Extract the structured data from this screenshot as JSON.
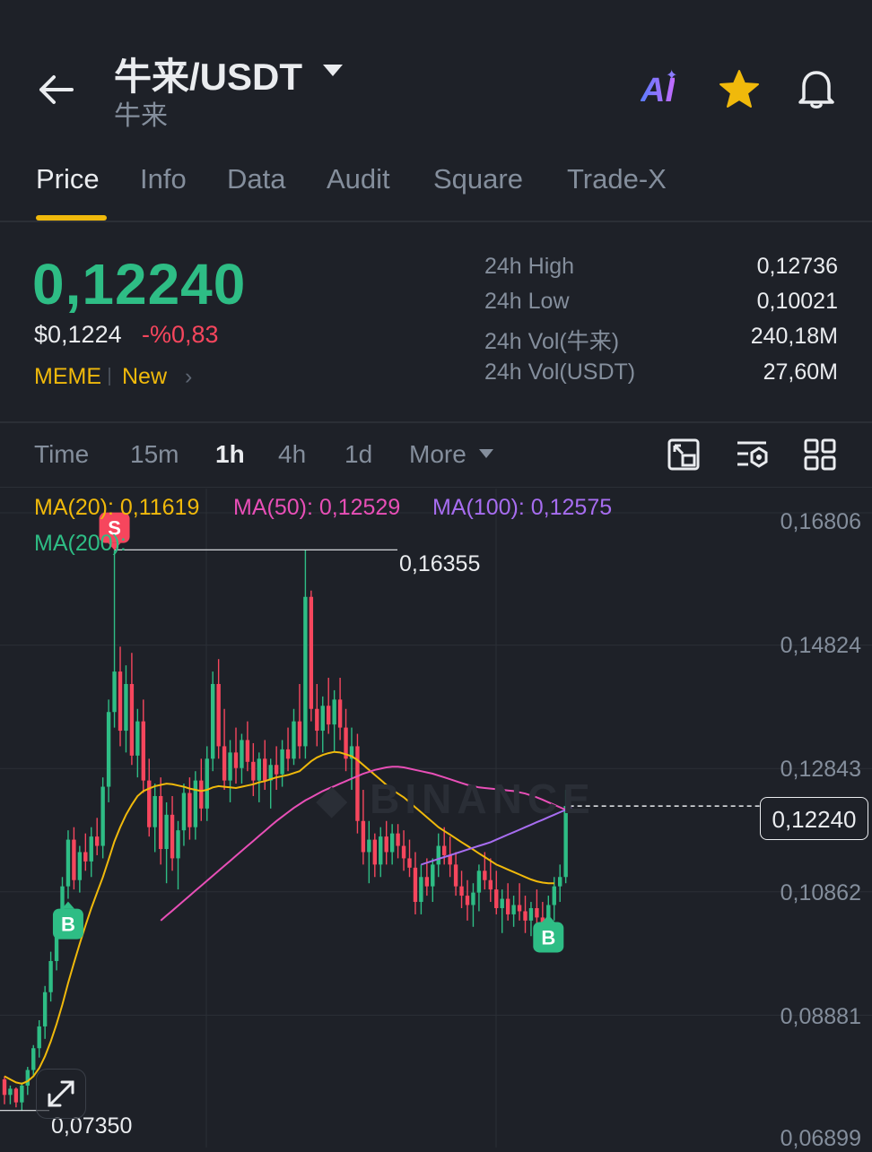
{
  "header": {
    "pair": "牛来/USDT",
    "subtitle": "牛来",
    "ai_label": "AI"
  },
  "tabs": [
    "Price",
    "Info",
    "Data",
    "Audit",
    "Square",
    "Trade-X"
  ],
  "price": {
    "last": "0,12240",
    "usd": "$0,1224",
    "change": "-%0,83",
    "tags": [
      "MEME",
      "New"
    ]
  },
  "stats": [
    {
      "label": "24h High",
      "value": "0,12736"
    },
    {
      "label": "24h Low",
      "value": "0,10021"
    },
    {
      "label": "24h Vol(牛来)",
      "value": "240,18M"
    },
    {
      "label": "24h Vol(USDT)",
      "value": "27,60M"
    }
  ],
  "intervals": [
    "Time",
    "15m",
    "1h",
    "4h",
    "1d",
    "More"
  ],
  "active_interval": "1h",
  "ma_legend": [
    {
      "label": "MA(20): 0,11619",
      "color": "#f0b90b"
    },
    {
      "label": "MA(50): 0,12529",
      "color": "#e84fb7"
    },
    {
      "label": "MA(100): 0,12575",
      "color": "#a76df0"
    },
    {
      "label": "MA(200):",
      "color": "#2ebd85"
    }
  ],
  "colors": {
    "up": "#2ebd85",
    "down": "#f6465d",
    "accent": "#f0b90b",
    "ma20": "#f0b90b",
    "ma50": "#e84fb7",
    "ma100": "#a76df0",
    "background": "#1e2128"
  },
  "chart_data": {
    "type": "candlestick",
    "y_axis_labels": [
      "0,16806",
      "0,14824",
      "0,12843",
      "0,10862",
      "0,08881",
      "0,06899"
    ],
    "ylim": [
      0.06899,
      0.16806
    ],
    "max_marker": "0,16355",
    "min_marker": "0,07350",
    "last_price_label": "0,12240",
    "last_price": 0.1224,
    "max_value": 0.16355,
    "min_value": 0.0735,
    "signals": [
      {
        "type": "S",
        "index": 19,
        "price": 0.1635
      },
      {
        "type": "B",
        "index": 11,
        "price": 0.1085
      },
      {
        "type": "B",
        "index": 94,
        "price": 0.1055
      }
    ],
    "candles": [
      [
        0.0785,
        0.079,
        0.0745,
        0.076
      ],
      [
        0.076,
        0.0775,
        0.0745,
        0.077
      ],
      [
        0.077,
        0.0772,
        0.074,
        0.0748
      ],
      [
        0.0748,
        0.078,
        0.0735,
        0.0775
      ],
      [
        0.0775,
        0.0805,
        0.076,
        0.08
      ],
      [
        0.08,
        0.084,
        0.079,
        0.0835
      ],
      [
        0.0835,
        0.088,
        0.082,
        0.087
      ],
      [
        0.087,
        0.0935,
        0.085,
        0.0925
      ],
      [
        0.0925,
        0.099,
        0.091,
        0.0975
      ],
      [
        0.0975,
        0.1055,
        0.096,
        0.104
      ],
      [
        0.104,
        0.111,
        0.102,
        0.1095
      ],
      [
        0.1095,
        0.1185,
        0.1075,
        0.117
      ],
      [
        0.117,
        0.119,
        0.109,
        0.1105
      ],
      [
        0.1105,
        0.116,
        0.1085,
        0.115
      ],
      [
        0.115,
        0.118,
        0.112,
        0.1135
      ],
      [
        0.1135,
        0.119,
        0.111,
        0.1175
      ],
      [
        0.1175,
        0.1205,
        0.1145,
        0.116
      ],
      [
        0.116,
        0.127,
        0.114,
        0.1255
      ],
      [
        0.1255,
        0.1395,
        0.123,
        0.1375
      ],
      [
        0.1375,
        0.1635,
        0.135,
        0.144
      ],
      [
        0.144,
        0.148,
        0.132,
        0.1345
      ],
      [
        0.1345,
        0.145,
        0.131,
        0.142
      ],
      [
        0.142,
        0.147,
        0.129,
        0.1305
      ],
      [
        0.1305,
        0.138,
        0.127,
        0.136
      ],
      [
        0.136,
        0.1395,
        0.1245,
        0.1265
      ],
      [
        0.1265,
        0.13,
        0.1175,
        0.119
      ],
      [
        0.119,
        0.126,
        0.115,
        0.124
      ],
      [
        0.124,
        0.127,
        0.113,
        0.1155
      ],
      [
        0.1155,
        0.123,
        0.11,
        0.121
      ],
      [
        0.121,
        0.124,
        0.112,
        0.114
      ],
      [
        0.114,
        0.12,
        0.109,
        0.1185
      ],
      [
        0.1185,
        0.126,
        0.116,
        0.1245
      ],
      [
        0.1245,
        0.127,
        0.117,
        0.119
      ],
      [
        0.119,
        0.128,
        0.117,
        0.1265
      ],
      [
        0.1265,
        0.13,
        0.12,
        0.122
      ],
      [
        0.122,
        0.132,
        0.12,
        0.13
      ],
      [
        0.13,
        0.144,
        0.128,
        0.142
      ],
      [
        0.142,
        0.146,
        0.13,
        0.132
      ],
      [
        0.132,
        0.138,
        0.125,
        0.1265
      ],
      [
        0.1265,
        0.133,
        0.123,
        0.131
      ],
      [
        0.131,
        0.135,
        0.126,
        0.1285
      ],
      [
        0.1285,
        0.134,
        0.126,
        0.133
      ],
      [
        0.133,
        0.136,
        0.128,
        0.1295
      ],
      [
        0.1295,
        0.1325,
        0.124,
        0.1265
      ],
      [
        0.1265,
        0.131,
        0.123,
        0.13
      ],
      [
        0.13,
        0.133,
        0.125,
        0.1265
      ],
      [
        0.1265,
        0.13,
        0.122,
        0.129
      ],
      [
        0.129,
        0.132,
        0.125,
        0.1275
      ],
      [
        0.1275,
        0.133,
        0.1255,
        0.1315
      ],
      [
        0.1315,
        0.135,
        0.128,
        0.13
      ],
      [
        0.13,
        0.138,
        0.129,
        0.136
      ],
      [
        0.136,
        0.142,
        0.13,
        0.132
      ],
      [
        0.132,
        0.1635,
        0.13,
        0.156
      ],
      [
        0.156,
        0.157,
        0.136,
        0.138
      ],
      [
        0.138,
        0.142,
        0.132,
        0.1345
      ],
      [
        0.1345,
        0.14,
        0.131,
        0.1385
      ],
      [
        0.1385,
        0.143,
        0.134,
        0.1355
      ],
      [
        0.1355,
        0.141,
        0.131,
        0.1395
      ],
      [
        0.1395,
        0.143,
        0.133,
        0.135
      ],
      [
        0.135,
        0.138,
        0.128,
        0.13
      ],
      [
        0.13,
        0.135,
        0.125,
        0.132
      ],
      [
        0.132,
        0.134,
        0.118,
        0.12
      ],
      [
        0.12,
        0.125,
        0.113,
        0.115
      ],
      [
        0.115,
        0.12,
        0.11,
        0.117
      ],
      [
        0.117,
        0.118,
        0.111,
        0.113
      ],
      [
        0.113,
        0.119,
        0.111,
        0.1175
      ],
      [
        0.1175,
        0.12,
        0.113,
        0.115
      ],
      [
        0.115,
        0.1195,
        0.113,
        0.118
      ],
      [
        0.118,
        0.1195,
        0.114,
        0.116
      ],
      [
        0.116,
        0.1185,
        0.112,
        0.114
      ],
      [
        0.114,
        0.117,
        0.111,
        0.1125
      ],
      [
        0.1125,
        0.115,
        0.105,
        0.107
      ],
      [
        0.107,
        0.113,
        0.105,
        0.111
      ],
      [
        0.111,
        0.114,
        0.108,
        0.1095
      ],
      [
        0.1095,
        0.114,
        0.107,
        0.113
      ],
      [
        0.113,
        0.118,
        0.111,
        0.116
      ],
      [
        0.116,
        0.119,
        0.113,
        0.1145
      ],
      [
        0.1145,
        0.1175,
        0.111,
        0.113
      ],
      [
        0.113,
        0.115,
        0.108,
        0.1095
      ],
      [
        0.1095,
        0.112,
        0.106,
        0.108
      ],
      [
        0.108,
        0.1105,
        0.104,
        0.1065
      ],
      [
        0.1065,
        0.11,
        0.103,
        0.1085
      ],
      [
        0.1085,
        0.113,
        0.1055,
        0.112
      ],
      [
        0.112,
        0.115,
        0.109,
        0.1105
      ],
      [
        0.1105,
        0.114,
        0.107,
        0.109
      ],
      [
        0.109,
        0.112,
        0.105,
        0.106
      ],
      [
        0.106,
        0.109,
        0.102,
        0.1075
      ],
      [
        0.1075,
        0.11,
        0.104,
        0.105
      ],
      [
        0.105,
        0.108,
        0.103,
        0.1065
      ],
      [
        0.1065,
        0.11,
        0.104,
        0.1055
      ],
      [
        0.1055,
        0.108,
        0.102,
        0.104
      ],
      [
        0.104,
        0.107,
        0.1015,
        0.106
      ],
      [
        0.106,
        0.109,
        0.1035,
        0.1045
      ],
      [
        0.1045,
        0.107,
        0.1002,
        0.1025
      ],
      [
        0.1025,
        0.108,
        0.101,
        0.1065
      ],
      [
        0.1065,
        0.111,
        0.104,
        0.1095
      ],
      [
        0.1095,
        0.113,
        0.107,
        0.111
      ],
      [
        0.111,
        0.125,
        0.11,
        0.1224
      ]
    ],
    "ma20": [
      0.079,
      0.0785,
      0.078,
      0.0778,
      0.0782,
      0.079,
      0.0803,
      0.0822,
      0.0846,
      0.0874,
      0.0905,
      0.094,
      0.0972,
      0.1003,
      0.1032,
      0.106,
      0.1085,
      0.111,
      0.1138,
      0.1167,
      0.119,
      0.121,
      0.1226,
      0.124,
      0.1248,
      0.1252,
      0.1256,
      0.1258,
      0.126,
      0.1259,
      0.1257,
      0.1255,
      0.1252,
      0.125,
      0.1248,
      0.125,
      0.1254,
      0.1256,
      0.1255,
      0.1254,
      0.1253,
      0.1255,
      0.1257,
      0.1259,
      0.1262,
      0.1264,
      0.1267,
      0.127,
      0.1272,
      0.1274,
      0.1277,
      0.128,
      0.1288,
      0.1296,
      0.1302,
      0.1306,
      0.1309,
      0.1311,
      0.131,
      0.1307,
      0.1304,
      0.1298,
      0.129,
      0.1282,
      0.1274,
      0.1266,
      0.1258,
      0.125,
      0.1244,
      0.1238,
      0.123,
      0.1222,
      0.1214,
      0.1206,
      0.1198,
      0.119,
      0.1184,
      0.1178,
      0.1172,
      0.1166,
      0.116,
      0.1154,
      0.1148,
      0.1142,
      0.1136,
      0.113,
      0.1126,
      0.1122,
      0.1118,
      0.1114,
      0.111,
      0.1106,
      0.1103,
      0.1101,
      0.11,
      0.11
    ],
    "ma50_start_index": 27,
    "ma50": [
      0.104,
      0.1048,
      0.1056,
      0.1064,
      0.1072,
      0.108,
      0.1088,
      0.1096,
      0.1104,
      0.1112,
      0.112,
      0.1128,
      0.1136,
      0.1144,
      0.1152,
      0.116,
      0.1168,
      0.1176,
      0.1184,
      0.1192,
      0.12,
      0.1207,
      0.1214,
      0.1221,
      0.1227,
      0.1233,
      0.1238,
      0.1243,
      0.1248,
      0.1252,
      0.1256,
      0.126,
      0.1264,
      0.1268,
      0.1272,
      0.1276,
      0.1279,
      0.1282,
      0.1284,
      0.1286,
      0.1287,
      0.1287,
      0.1286,
      0.1284,
      0.1282,
      0.128,
      0.1278,
      0.1276,
      0.1273,
      0.127,
      0.1267,
      0.1264,
      0.1261,
      0.1258,
      0.1256,
      0.1254,
      0.1253,
      0.1252,
      0.1251,
      0.125,
      0.1249,
      0.1248,
      0.1246,
      0.1244,
      0.1241,
      0.1238,
      0.1234,
      0.123,
      0.1226,
      0.1222,
      0.1218
    ],
    "ma100_start_index": 72,
    "ma100": [
      0.113,
      0.1133,
      0.1136,
      0.1139,
      0.1142,
      0.1145,
      0.1148,
      0.1151,
      0.1154,
      0.1157,
      0.116,
      0.1163,
      0.1166,
      0.117,
      0.1174,
      0.1178,
      0.1182,
      0.1186,
      0.119,
      0.1194,
      0.1198,
      0.1202,
      0.1206,
      0.121,
      0.1214,
      0.1218,
      0.1222
    ]
  }
}
